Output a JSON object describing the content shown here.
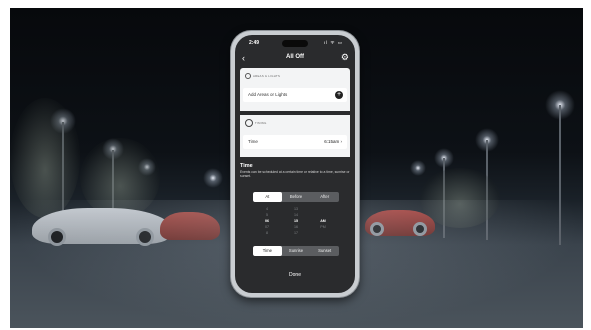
{
  "status_bar": {
    "time": "2:49",
    "icons": "ıl ᯤ ▭"
  },
  "nav": {
    "back_icon": "chevron-left-icon",
    "back_glyph": "‹",
    "title": "All Off",
    "settings_icon": "gear-icon",
    "settings_glyph": "⚙"
  },
  "areas_section": {
    "label": "AREAS & LIGHTS",
    "field_placeholder": "Add Areas or Lights",
    "add_glyph": "+"
  },
  "timing_section": {
    "label": "TIMING",
    "field_label": "Time",
    "field_value": "6:15am ›"
  },
  "time_info": {
    "heading": "Time",
    "description": "Events can be scheduled at a certain time or relative to a time, sunrise or sunset."
  },
  "relation_segment": {
    "options": [
      "At",
      "Before",
      "After"
    ],
    "selected": "At"
  },
  "picker": {
    "hours": [
      "4",
      "5",
      "06",
      "07",
      "8"
    ],
    "minutes": [
      "13",
      "14",
      "15",
      "16",
      "17"
    ],
    "period": [
      "",
      "",
      "AM",
      "PM",
      ""
    ]
  },
  "type_segment": {
    "options": [
      "Time",
      "Sunrise",
      "Sunset"
    ],
    "selected": "Time"
  },
  "done_label": "Done"
}
